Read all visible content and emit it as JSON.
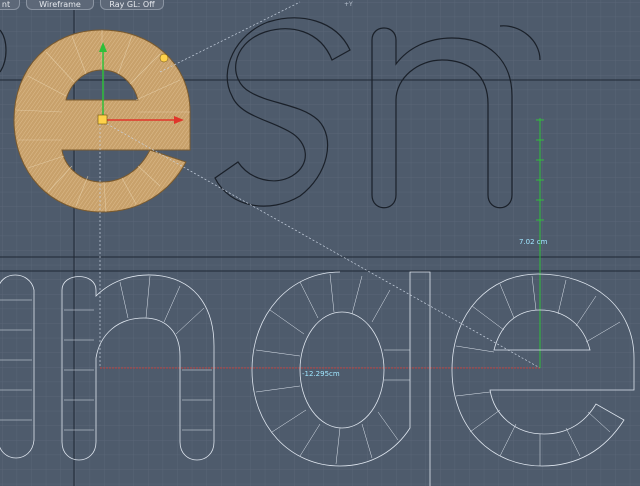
{
  "toolbar": {
    "view_label": "nt",
    "shading_label": "Wireframe",
    "raygl_label": "Ray GL: Off"
  },
  "viewport": {
    "axis_tag": "+Y",
    "measure_horizontal": "-12.295cm",
    "measure_vertical": "7.02 cm"
  },
  "colors": {
    "background": "#4e5b6c",
    "grid_minor": "#5c6879",
    "grid_major": "#1c2430",
    "selection_fill": "#c9a06a",
    "x_handle": "#e0362b",
    "y_handle": "#2fbf3a",
    "measure": "#9fe6ff"
  }
}
